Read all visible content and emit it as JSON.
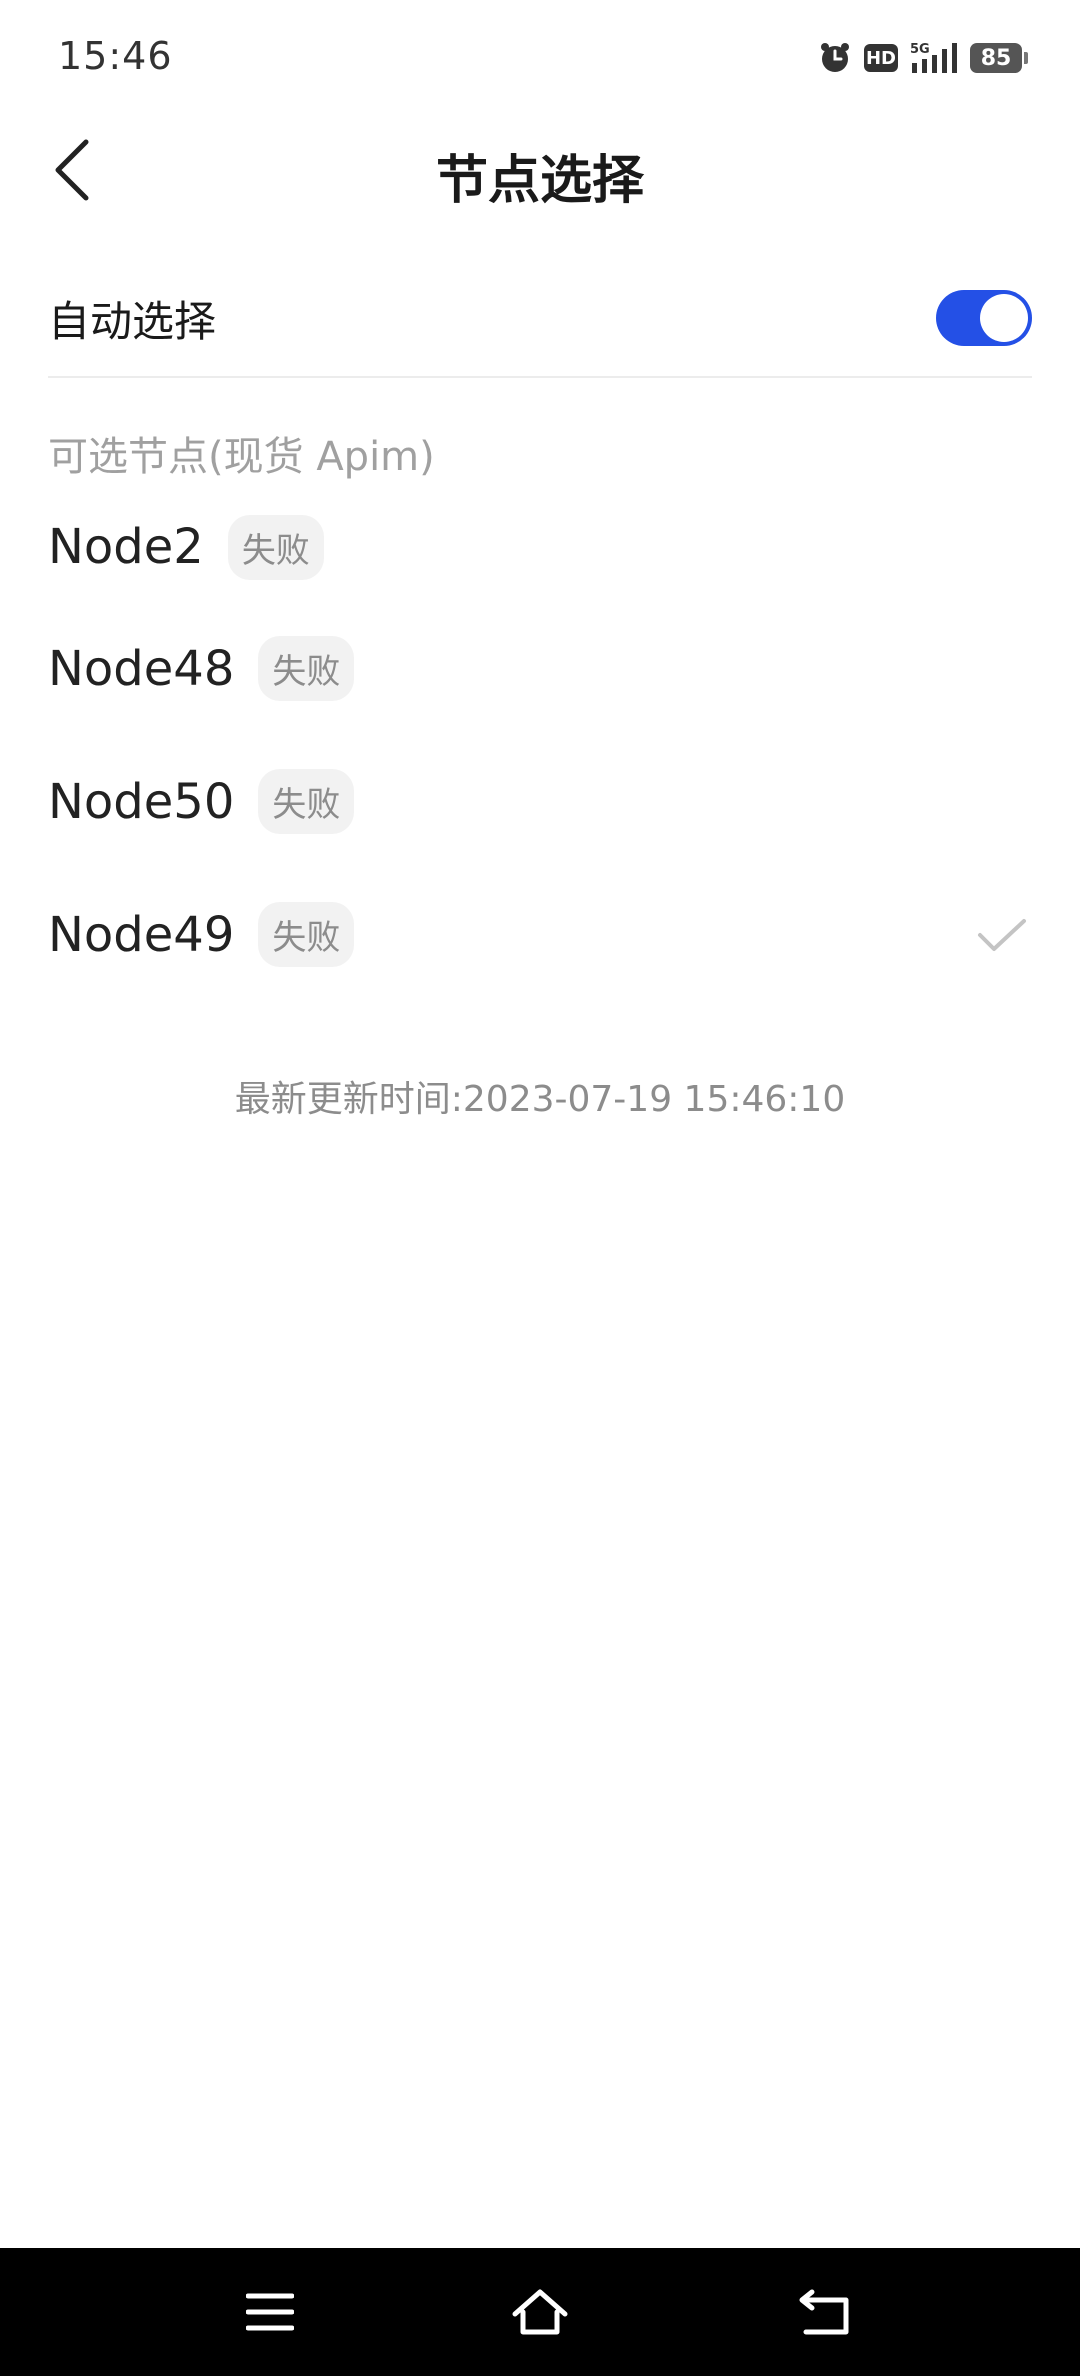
{
  "status_bar": {
    "time": "15:46",
    "icons": [
      "alarm-icon",
      "hd-icon",
      "5g-signal-icon",
      "battery-icon"
    ],
    "hd_label": "HD",
    "network_label": "5G",
    "battery_level": "85"
  },
  "header": {
    "title": "节点选择"
  },
  "auto_select": {
    "label": "自动选择",
    "enabled": true,
    "toggle_color": "#2450e6"
  },
  "section": {
    "label": "可选节点(现货 Apim)"
  },
  "nodes": [
    {
      "name": "Node2",
      "status": "失败",
      "selected": false
    },
    {
      "name": "Node48",
      "status": "失败",
      "selected": false
    },
    {
      "name": "Node50",
      "status": "失败",
      "selected": false
    },
    {
      "name": "Node49",
      "status": "失败",
      "selected": true
    }
  ],
  "footer": {
    "update_time": "最新更新时间:2023-07-19 15:46:10"
  },
  "nav_bar": {
    "buttons": [
      "menu-icon",
      "home-icon",
      "back-icon"
    ]
  }
}
